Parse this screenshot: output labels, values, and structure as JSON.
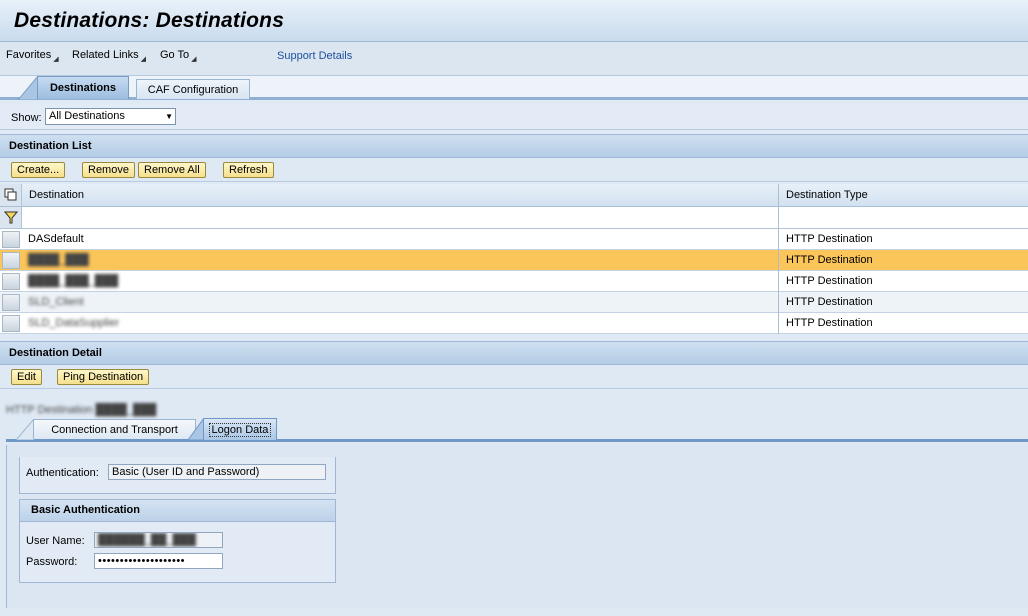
{
  "window": {
    "title": "Destinations: Destinations"
  },
  "menu": {
    "favorites": "Favorites",
    "related_links": "Related Links",
    "go_to": "Go To",
    "support_details": "Support Details"
  },
  "tabs": [
    {
      "label": "Destinations",
      "active": true
    },
    {
      "label": "CAF Configuration",
      "active": false
    }
  ],
  "filter": {
    "label": "Show:",
    "selected": "All Destinations"
  },
  "destination_list": {
    "title": "Destination List",
    "buttons": {
      "create": "Create...",
      "remove": "Remove",
      "remove_all": "Remove All",
      "refresh": "Refresh"
    },
    "columns": [
      "Destination",
      "Destination Type"
    ],
    "rows": [
      {
        "name": "DASdefault",
        "type": "HTTP Destination",
        "selected": false,
        "redacted": false
      },
      {
        "name": "████_███",
        "type": "HTTP Destination",
        "selected": true,
        "redacted": true
      },
      {
        "name": "████_███_███",
        "type": "HTTP Destination",
        "selected": false,
        "redacted": true
      },
      {
        "name": "SLD_Client",
        "type": "HTTP Destination",
        "selected": false,
        "redacted": true
      },
      {
        "name": "SLD_DataSupplier",
        "type": "HTTP Destination",
        "selected": false,
        "redacted": true
      }
    ]
  },
  "destination_detail": {
    "title": "Destination Detail",
    "buttons": {
      "edit": "Edit",
      "ping": "Ping Destination"
    },
    "caption": "HTTP Destination ████_███",
    "sub_tabs": [
      {
        "label": "Connection and Transport",
        "active": false
      },
      {
        "label": "Logon Data",
        "active": true
      }
    ],
    "authentication": {
      "label": "Authentication:",
      "value": "Basic (User ID and Password)"
    },
    "basic_auth": {
      "title": "Basic Authentication",
      "user_label": "User Name:",
      "user_value": "██████_██_███",
      "password_label": "Password:",
      "password_value": "••••••••••••••••••••"
    }
  },
  "colors": {
    "selected_row": "#fbc55a",
    "button": "#f5e08c",
    "link": "#1e4f9c"
  }
}
